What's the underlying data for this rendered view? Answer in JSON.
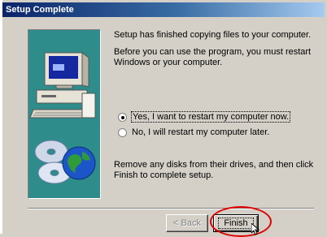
{
  "window": {
    "title": "Setup Complete"
  },
  "content": {
    "msg1": "Setup has finished copying files to your computer.",
    "msg2": "Before you can use the program, you must restart Windows or your computer.",
    "option_yes": "Yes, I want to restart my computer now.",
    "option_no": "No, I will restart my computer later.",
    "selected_option": "yes",
    "msg3": "Remove any disks from their drives, and then click Finish to complete setup."
  },
  "buttons": {
    "back": "< Back",
    "finish": "Finish"
  },
  "colors": {
    "banner": "#2e8d8a",
    "annotation": "#e00000",
    "titlebar_start": "#0a246a"
  }
}
